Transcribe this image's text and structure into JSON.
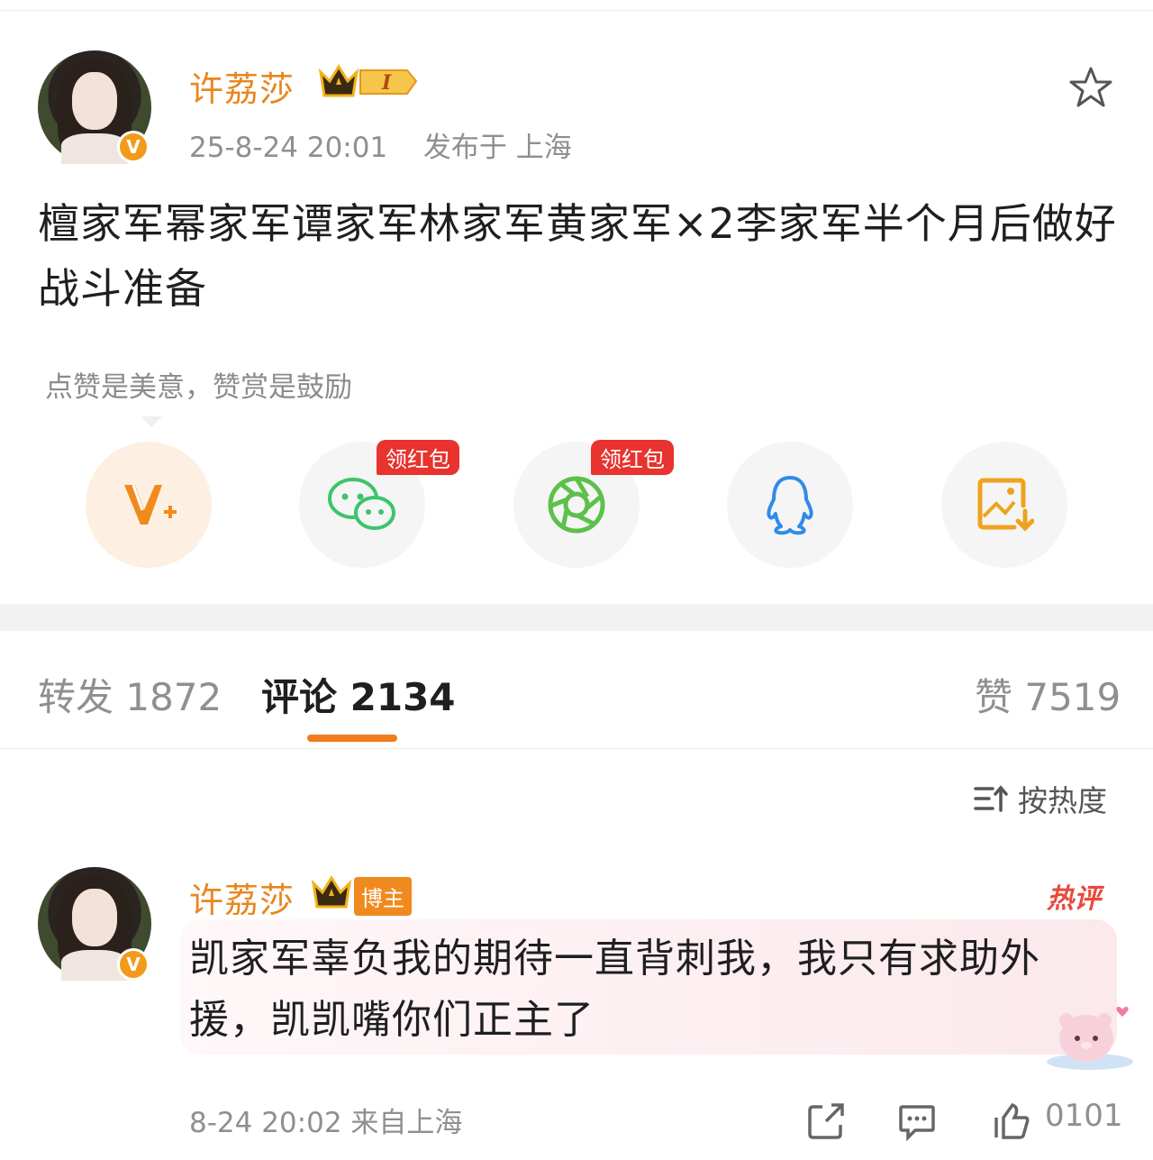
{
  "post": {
    "author": "许荔莎",
    "level_badge": "I",
    "verified_mark": "V",
    "timestamp": "25-8-24 20:01",
    "location": "发布于 上海",
    "text": "檀家军幂家军谭家军林家军黄家军×2李家军半个月后做好战斗准备",
    "tip": "点赞是美意，赞赏是鼓励"
  },
  "share": {
    "items": [
      {
        "icon": "vplus-icon"
      },
      {
        "icon": "wechat-icon",
        "tag": "领红包"
      },
      {
        "icon": "moments-icon",
        "tag": "领红包"
      },
      {
        "icon": "qq-icon"
      },
      {
        "icon": "save-image-icon"
      }
    ]
  },
  "tabs": {
    "repost_label": "转发 1872",
    "comment_label": "评论 2134",
    "like_label": "赞 7519"
  },
  "sort": {
    "label": "按热度"
  },
  "comment": {
    "author": "许荔莎",
    "author_tag": "博主",
    "hot_label": "热评",
    "verified_mark": "V",
    "text": "凯家军辜负我的期待一直背刺我，我只有求助外援，凯凯嘴你们正主了",
    "meta": "8-24 20:02 来自上海",
    "like_count": "0101"
  },
  "colors": {
    "accent": "#f27b1a",
    "username": "#e8871e",
    "redpacket": "#e8332e",
    "wechat": "#3cc46b",
    "qq": "#2f8be8"
  }
}
